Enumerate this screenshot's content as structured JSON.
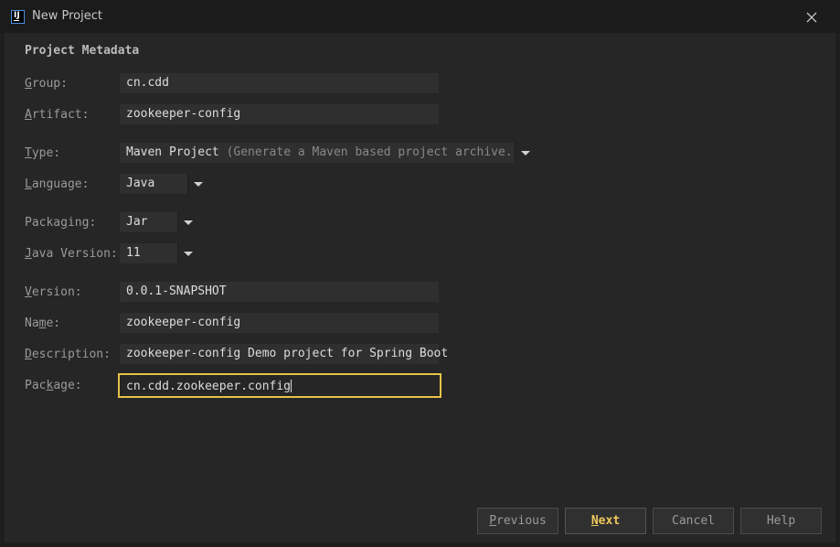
{
  "window": {
    "title": "New Project",
    "app_icon_text": "IJ"
  },
  "section_title": "Project Metadata",
  "fields": {
    "group": {
      "label_mn": "G",
      "label_rest": "roup:",
      "value": "cn.cdd"
    },
    "artifact": {
      "label_mn": "A",
      "label_rest": "rtifact:",
      "value": "zookeeper-config"
    },
    "type": {
      "label_mn": "T",
      "label_rest": "ype:",
      "value": "Maven Project",
      "hint": "(Generate a Maven based project archive.)"
    },
    "language": {
      "label_mn": "L",
      "label_rest": "anguage:",
      "value": "Java"
    },
    "packaging": {
      "label_pre": "Packa",
      "label_mn": "g",
      "label_rest": "ing:",
      "value": "Jar"
    },
    "java_version": {
      "label_mn": "J",
      "label_rest": "ava Version:",
      "value": "11"
    },
    "version": {
      "label_mn": "V",
      "label_rest": "ersion:",
      "value": "0.0.1-SNAPSHOT"
    },
    "name": {
      "label_pre": "Na",
      "label_mn": "m",
      "label_rest": "e:",
      "value": "zookeeper-config"
    },
    "description": {
      "label_mn": "D",
      "label_rest": "escription:",
      "value": "zookeeper-config Demo project for Spring Boot"
    },
    "package": {
      "label_pre": "Pac",
      "label_mn": "k",
      "label_rest": "age:",
      "value": "cn.cdd.zookeeper.config"
    }
  },
  "buttons": {
    "previous": {
      "mn": "P",
      "rest": "revious"
    },
    "next": {
      "mn": "N",
      "rest": "ext"
    },
    "cancel": {
      "label": "Cancel"
    },
    "help": {
      "label": "Help"
    }
  },
  "colors": {
    "accent": "#e6c34a",
    "background": "#262626",
    "field_bg": "#2f2f2f"
  }
}
